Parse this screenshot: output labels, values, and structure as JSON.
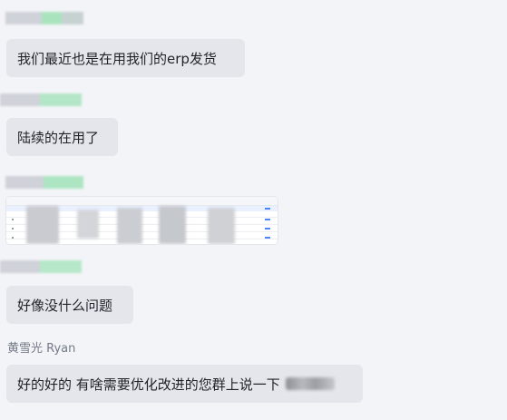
{
  "messages": [
    {
      "sender": "",
      "text": "我们最近也是在用我们的erp发货"
    },
    {
      "sender": "",
      "text": "陆续的在用了"
    },
    {
      "sender": "",
      "text": ""
    },
    {
      "sender": "",
      "text": "好像没什么问题"
    },
    {
      "sender": "黄雪光 Ryan",
      "text": "好的好的 有啥需要优化改进的您群上说一下"
    }
  ],
  "colors": {
    "background": "#f3f4f8",
    "bubble": "#e4e6eb",
    "text": "#1f2329",
    "sender_name": "#737a86"
  }
}
